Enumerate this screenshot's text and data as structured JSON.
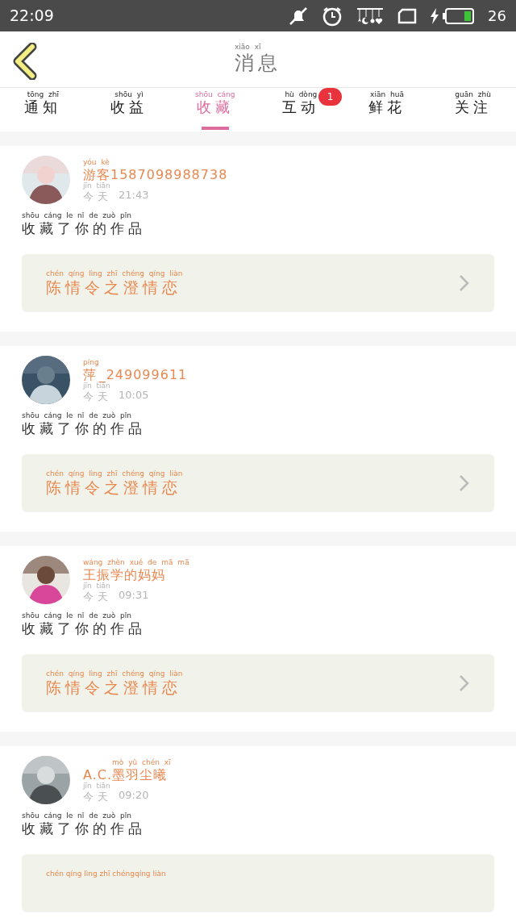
{
  "status_bar": {
    "time": "22:09",
    "battery": "26"
  },
  "header": {
    "title": [
      {
        "text": "消息",
        "pinyin": "xiāo xī"
      }
    ]
  },
  "tabs": [
    {
      "label": [
        {
          "text": "通知",
          "pinyin": "tōng zhī"
        }
      ],
      "selected": false
    },
    {
      "label": [
        {
          "text": "收益",
          "pinyin": "shōu yì"
        }
      ],
      "selected": false
    },
    {
      "label": [
        {
          "text": "收藏",
          "pinyin": "shōu cáng"
        }
      ],
      "selected": true
    },
    {
      "label": [
        {
          "text": "互动",
          "pinyin": "hù dòng"
        }
      ],
      "selected": false,
      "badge": "1"
    },
    {
      "label": [
        {
          "text": "鲜花",
          "pinyin": "xiān huā"
        }
      ],
      "selected": false
    },
    {
      "label": [
        {
          "text": "关注",
          "pinyin": "guān zhù"
        }
      ],
      "selected": false
    }
  ],
  "messages": [
    {
      "avatar": {
        "kind": "picture"
      },
      "name": [
        {
          "text": "游客",
          "pinyin": "yóu kè"
        },
        {
          "text": "1587098988738"
        }
      ],
      "date": [
        {
          "text": "今天",
          "pinyin": "jīn tiān"
        }
      ],
      "time": "21:43",
      "action": [
        {
          "text": "收藏了你的作品",
          "pinyin": "shōu cáng le nǐ de zuò pǐn"
        }
      ],
      "work": [
        {
          "text": "陈情令之澄情恋",
          "pinyin": "chén qíng lìng zhī chéng qíng liàn"
        }
      ]
    },
    {
      "avatar": {
        "kind": "picture"
      },
      "name": [
        {
          "text": "萍",
          "pinyin": "píng"
        },
        {
          "text": "_249099611"
        }
      ],
      "date": [
        {
          "text": "今天",
          "pinyin": "jīn tiān"
        }
      ],
      "time": "10:05",
      "action": [
        {
          "text": "收藏了你的作品",
          "pinyin": "shōu cáng le nǐ de zuò pǐn"
        }
      ],
      "work": [
        {
          "text": "陈情令之澄情恋",
          "pinyin": "chén qíng lìng zhī chéng qíng liàn"
        }
      ]
    },
    {
      "avatar": {
        "kind": "picture"
      },
      "name": [
        {
          "text": "王振学的妈妈",
          "pinyin": "wáng zhèn xué de mā mā"
        }
      ],
      "date": [
        {
          "text": "今天",
          "pinyin": "jīn tiān"
        }
      ],
      "time": "09:31",
      "action": [
        {
          "text": "收藏了你的作品",
          "pinyin": "shōu cáng le nǐ de zuò pǐn"
        }
      ],
      "work": [
        {
          "text": "陈情令之澄情恋",
          "pinyin": "chén qíng lìng zhī chéng qíng liàn"
        }
      ]
    },
    {
      "avatar": {
        "kind": "picture"
      },
      "name": [
        {
          "text": "A.C. "
        },
        {
          "text": "墨羽尘曦",
          "pinyin": "mò yǔ chén xī"
        }
      ],
      "date": [
        {
          "text": "今天",
          "pinyin": "jīn tiān"
        }
      ],
      "time": "09:20",
      "action": [
        {
          "text": "收藏了你的作品",
          "pinyin": "shōu cáng le nǐ de zuò pǐn"
        }
      ],
      "work_cut": "chén qíng lìng zhī chéngqíng liàn"
    }
  ]
}
